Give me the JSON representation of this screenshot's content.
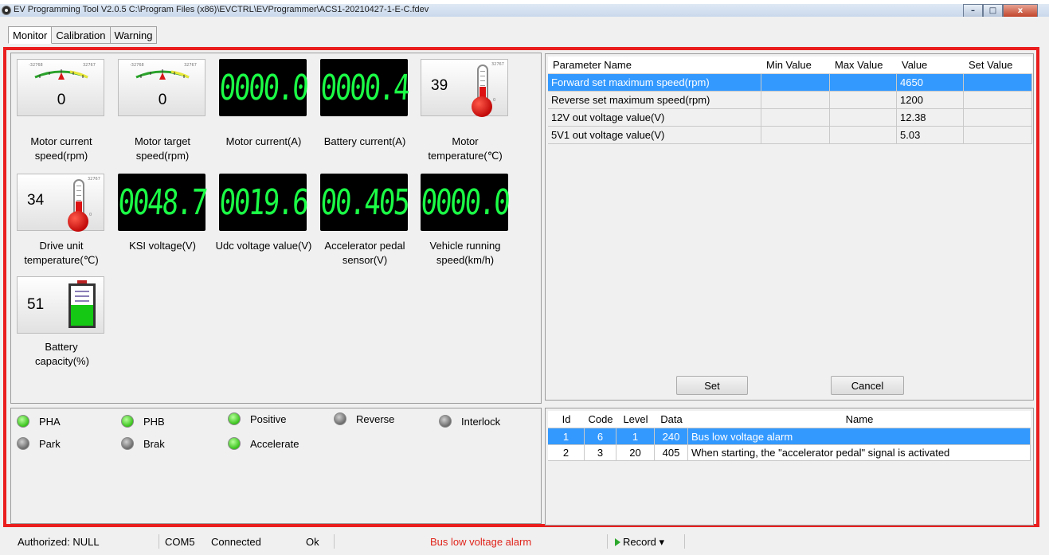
{
  "window": {
    "title": "EV Programming Tool V2.0.5 C:\\Program Files (x86)\\EVCTRL\\EVProgrammer\\ACS1-20210427-1-E-C.fdev",
    "buttons": {
      "minimize": "–",
      "maximize": "□",
      "close": "x"
    }
  },
  "tabs": [
    "Monitor",
    "Calibration",
    "Warning"
  ],
  "gauges": {
    "motor_speed": {
      "value": "0",
      "label": "Motor current speed(rpm)",
      "scale_min": "-32768",
      "scale_max": "32767"
    },
    "target_speed": {
      "value": "0",
      "label": "Motor target speed(rpm)",
      "scale_min": "-32768",
      "scale_max": "32767"
    },
    "motor_current": {
      "value": "0000.0",
      "label": "Motor current(A)"
    },
    "battery_current": {
      "value": "0000.4",
      "label": "Battery current(A)"
    },
    "motor_temp": {
      "value": "39",
      "label": "Motor temperature(℃)",
      "scale_max": "32767",
      "scale_min": "0"
    },
    "drive_temp": {
      "value": "34",
      "label": "Drive unit temperature(℃)",
      "scale_max": "32767",
      "scale_min": "0"
    },
    "ksi": {
      "value": "0048.7",
      "label": "KSI voltage(V)"
    },
    "udc": {
      "value": "0019.6",
      "label": "Udc voltage value(V)"
    },
    "pedal": {
      "value": "00.405",
      "label": "Accelerator pedal sensor(V)"
    },
    "vehicle_speed": {
      "value": "0000.0",
      "label": "Vehicle running speed(km/h)"
    },
    "battery_capacity": {
      "value": "51",
      "label": "Battery capacity(%)",
      "fill_percent": 51
    }
  },
  "param_table": {
    "headers": [
      "Parameter Name",
      "Min Value",
      "Max Value",
      "Value",
      "Set Value"
    ],
    "rows": [
      {
        "name": "Forward set maximum speed(rpm)",
        "min": "",
        "max": "",
        "value": "4650",
        "set": ""
      },
      {
        "name": "Reverse set maximum speed(rpm)",
        "min": "",
        "max": "",
        "value": "1200",
        "set": ""
      },
      {
        "name": "12V out voltage value(V)",
        "min": "",
        "max": "",
        "value": "12.38",
        "set": ""
      },
      {
        "name": "5V1 out voltage value(V)",
        "min": "",
        "max": "",
        "value": "5.03",
        "set": ""
      }
    ],
    "set_button": "Set",
    "cancel_button": "Cancel"
  },
  "leds": [
    {
      "label": "PHA",
      "state": "on"
    },
    {
      "label": "PHB",
      "state": "on"
    },
    {
      "label": "Positive",
      "state": "on"
    },
    {
      "label": "Reverse",
      "state": "off"
    },
    {
      "label": "Interlock",
      "state": "off"
    },
    {
      "label": "Park",
      "state": "off"
    },
    {
      "label": "Brak",
      "state": "off"
    },
    {
      "label": "Accelerate",
      "state": "on"
    }
  ],
  "warning_table": {
    "headers": [
      "Id",
      "Code",
      "Level",
      "Data",
      "Name"
    ],
    "rows": [
      {
        "id": "1",
        "code": "6",
        "level": "1",
        "data": "240",
        "name": "Bus low voltage alarm"
      },
      {
        "id": "2",
        "code": "3",
        "level": "20",
        "data": "405",
        "name": "When starting, the \"accelerator pedal\" signal is activated"
      }
    ]
  },
  "statusbar": {
    "authorized": "Authorized: NULL",
    "port": "COM5",
    "connection": "Connected",
    "state": "Ok",
    "alarm": "Bus low voltage alarm",
    "record": "Record",
    "record_dropdown": "▾"
  },
  "colors": {
    "highlight": "#3399ff",
    "alarm_text": "#e0241b",
    "segment": "#1bff46",
    "frame": "#ea1e1e"
  }
}
